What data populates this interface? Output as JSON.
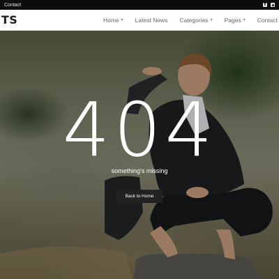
{
  "topbar": {
    "contact_label": "Contact",
    "socials": [
      {
        "icon": "facebook-icon"
      },
      {
        "icon": "instagram-icon"
      }
    ]
  },
  "header": {
    "logo": "NTS",
    "nav": [
      {
        "label": "Home",
        "has_dropdown": true
      },
      {
        "label": "Latest News",
        "has_dropdown": false
      },
      {
        "label": "Categories",
        "has_dropdown": true
      },
      {
        "label": "Pages",
        "has_dropdown": true
      },
      {
        "label": "Contact",
        "has_dropdown": false
      }
    ]
  },
  "hero": {
    "code": "404",
    "message": "something's missing",
    "button_label": "Back to Home"
  },
  "colors": {
    "topbar_bg": "#0d0d0d",
    "header_bg": "#ffffff",
    "button_bg": "#222222",
    "text_light": "#ffffff"
  }
}
